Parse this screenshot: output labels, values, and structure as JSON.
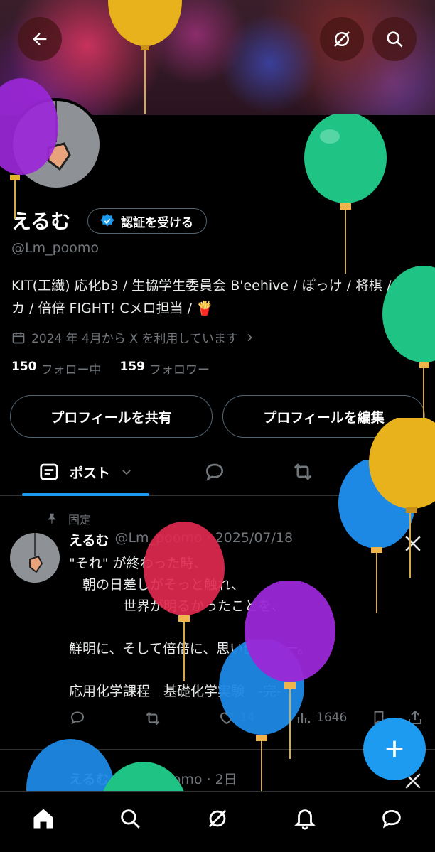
{
  "profile": {
    "name": "えるむ",
    "verify_label": "認証を受ける",
    "handle": "@Lm_poomo",
    "bio": "KIT(工繊) 応化b3 / 生協学生委員会 B'eehive / ぽっけ / 将棋 / モンカ / 倍倍 FIGHT! Cメロ担当 / 🍟",
    "joined": "2024 年 4月から X を利用しています",
    "following_count": "150",
    "following_label": "フォロー中",
    "followers_count": "159",
    "followers_label": "フォロワー"
  },
  "buttons": {
    "share": "プロフィールを共有",
    "edit": "プロフィールを編集"
  },
  "tabs": {
    "posts": "ポスト"
  },
  "pinned_post": {
    "pinned_label": "固定",
    "name": "えるむ",
    "handle_date": "@Lm_poomo · 2025/07/18",
    "body": "\"それ\" が終わった時、\n　朝の日差しがそっと触れ、\n　　　　世界が明るかったことを、\n\n鮮明に、そして倍倍に、思い出した一。\n\n応用化学課程　基礎化学実験　-完-",
    "likes": "14",
    "views": "1646"
  },
  "second_post": {
    "name": "えるむ",
    "handle_date": "@Lm_poomo · 2日"
  },
  "colors": {
    "accent": "#1d9bf0",
    "balloon_green": "#1fc384",
    "balloon_yellow": "#e8b21c",
    "balloon_blue": "#1e88e5",
    "balloon_purple": "#9b27d8",
    "balloon_red": "#e0294f"
  }
}
